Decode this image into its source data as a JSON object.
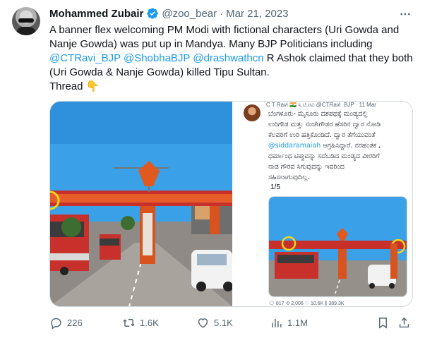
{
  "author": {
    "name": "Mohammed Zubair",
    "handle": "@zoo_bear",
    "separator": "·",
    "date": "Mar 21, 2023",
    "verified_icon": "verified-badge-icon"
  },
  "tweet_text": {
    "line1": "A banner flex welcoming PM Modi with fictional characters (Uri Gowda and",
    "line2": "Nanje Gowda) was put up in Mandya. Many BJP Politicians including",
    "mention1": "@CTRavi_BJP",
    "mention2": "@ShobhaBJP",
    "mention3": "@drashwathcn",
    "line3_tail": " R Ashok claimed that they both",
    "line4": "(Uri Gowda & Nanje Gowda) killed Tipu Sultan.",
    "line5": "Thread 👇"
  },
  "embedded_tweet": {
    "header": "C T Ravi 🇮🇳 ಸಿ.ಟಿ.ರವಿ  @CTRavi_BJP · 11 Mar",
    "lines": [
      "ಬೆಂಗಳೂರು- ಮೈಸೂರು ದಶಪಥಕ್ಕೆ ಮಂಡ್ಯದಲ್ಲಿ",
      "ಉರಿಗೌಡ ಮತ್ತು ನಂಜೇಗೌಡರ ಹೆಸರಿನ ದ್ವಾರ ನೋಡಿ",
      "ಕೆಲವರಿಗೆ ಉರಿ ಹತ್ತಿಕೊಂಡಿದೆ. ದ್ವಾರ ತೆಗೆಯುವಂತೆ",
      "ಆಗ್ರಹಿಸಿದ್ದಾರೆ. ನರಹಂತಕ ,",
      "ಧರ್ಮಾಂಧ ಟಿಪ್ಪುವನ್ನು ಸದೆಬಡಿದ ಮಂಡ್ಯದ ವೀರರಿಗೆ",
      "ನಾಡ ಗೌರವ ಸಿಗುವುದನ್ನು ಇವರಿಂದ",
      "ಸಹಿಸಲಾಗುವುದಿಲ್ಲ."
    ],
    "mention": "@siddaramaiah",
    "pager": "1/5",
    "action_counts": "🗨 817     ⟲ 2,006     ♡ 10.6K     ⫼ 389.3K"
  },
  "actions": {
    "reply_count": "226",
    "retweet_count": "1.6K",
    "like_count": "5.1K",
    "views_count": "1.1M"
  },
  "colors": {
    "accent": "#1d9bf0",
    "secondary_text": "#536471",
    "primary_text": "#0f1419",
    "border": "#cfd9de",
    "bus_red": "#c8312b",
    "sky": "#3aa0e8"
  },
  "icons": {
    "more": "more-dots-icon",
    "reply": "reply-icon",
    "retweet": "retweet-icon",
    "like": "heart-icon",
    "views": "views-chart-icon",
    "bookmark": "bookmark-icon",
    "share": "share-icon",
    "pointing": "pointing-down-emoji"
  }
}
